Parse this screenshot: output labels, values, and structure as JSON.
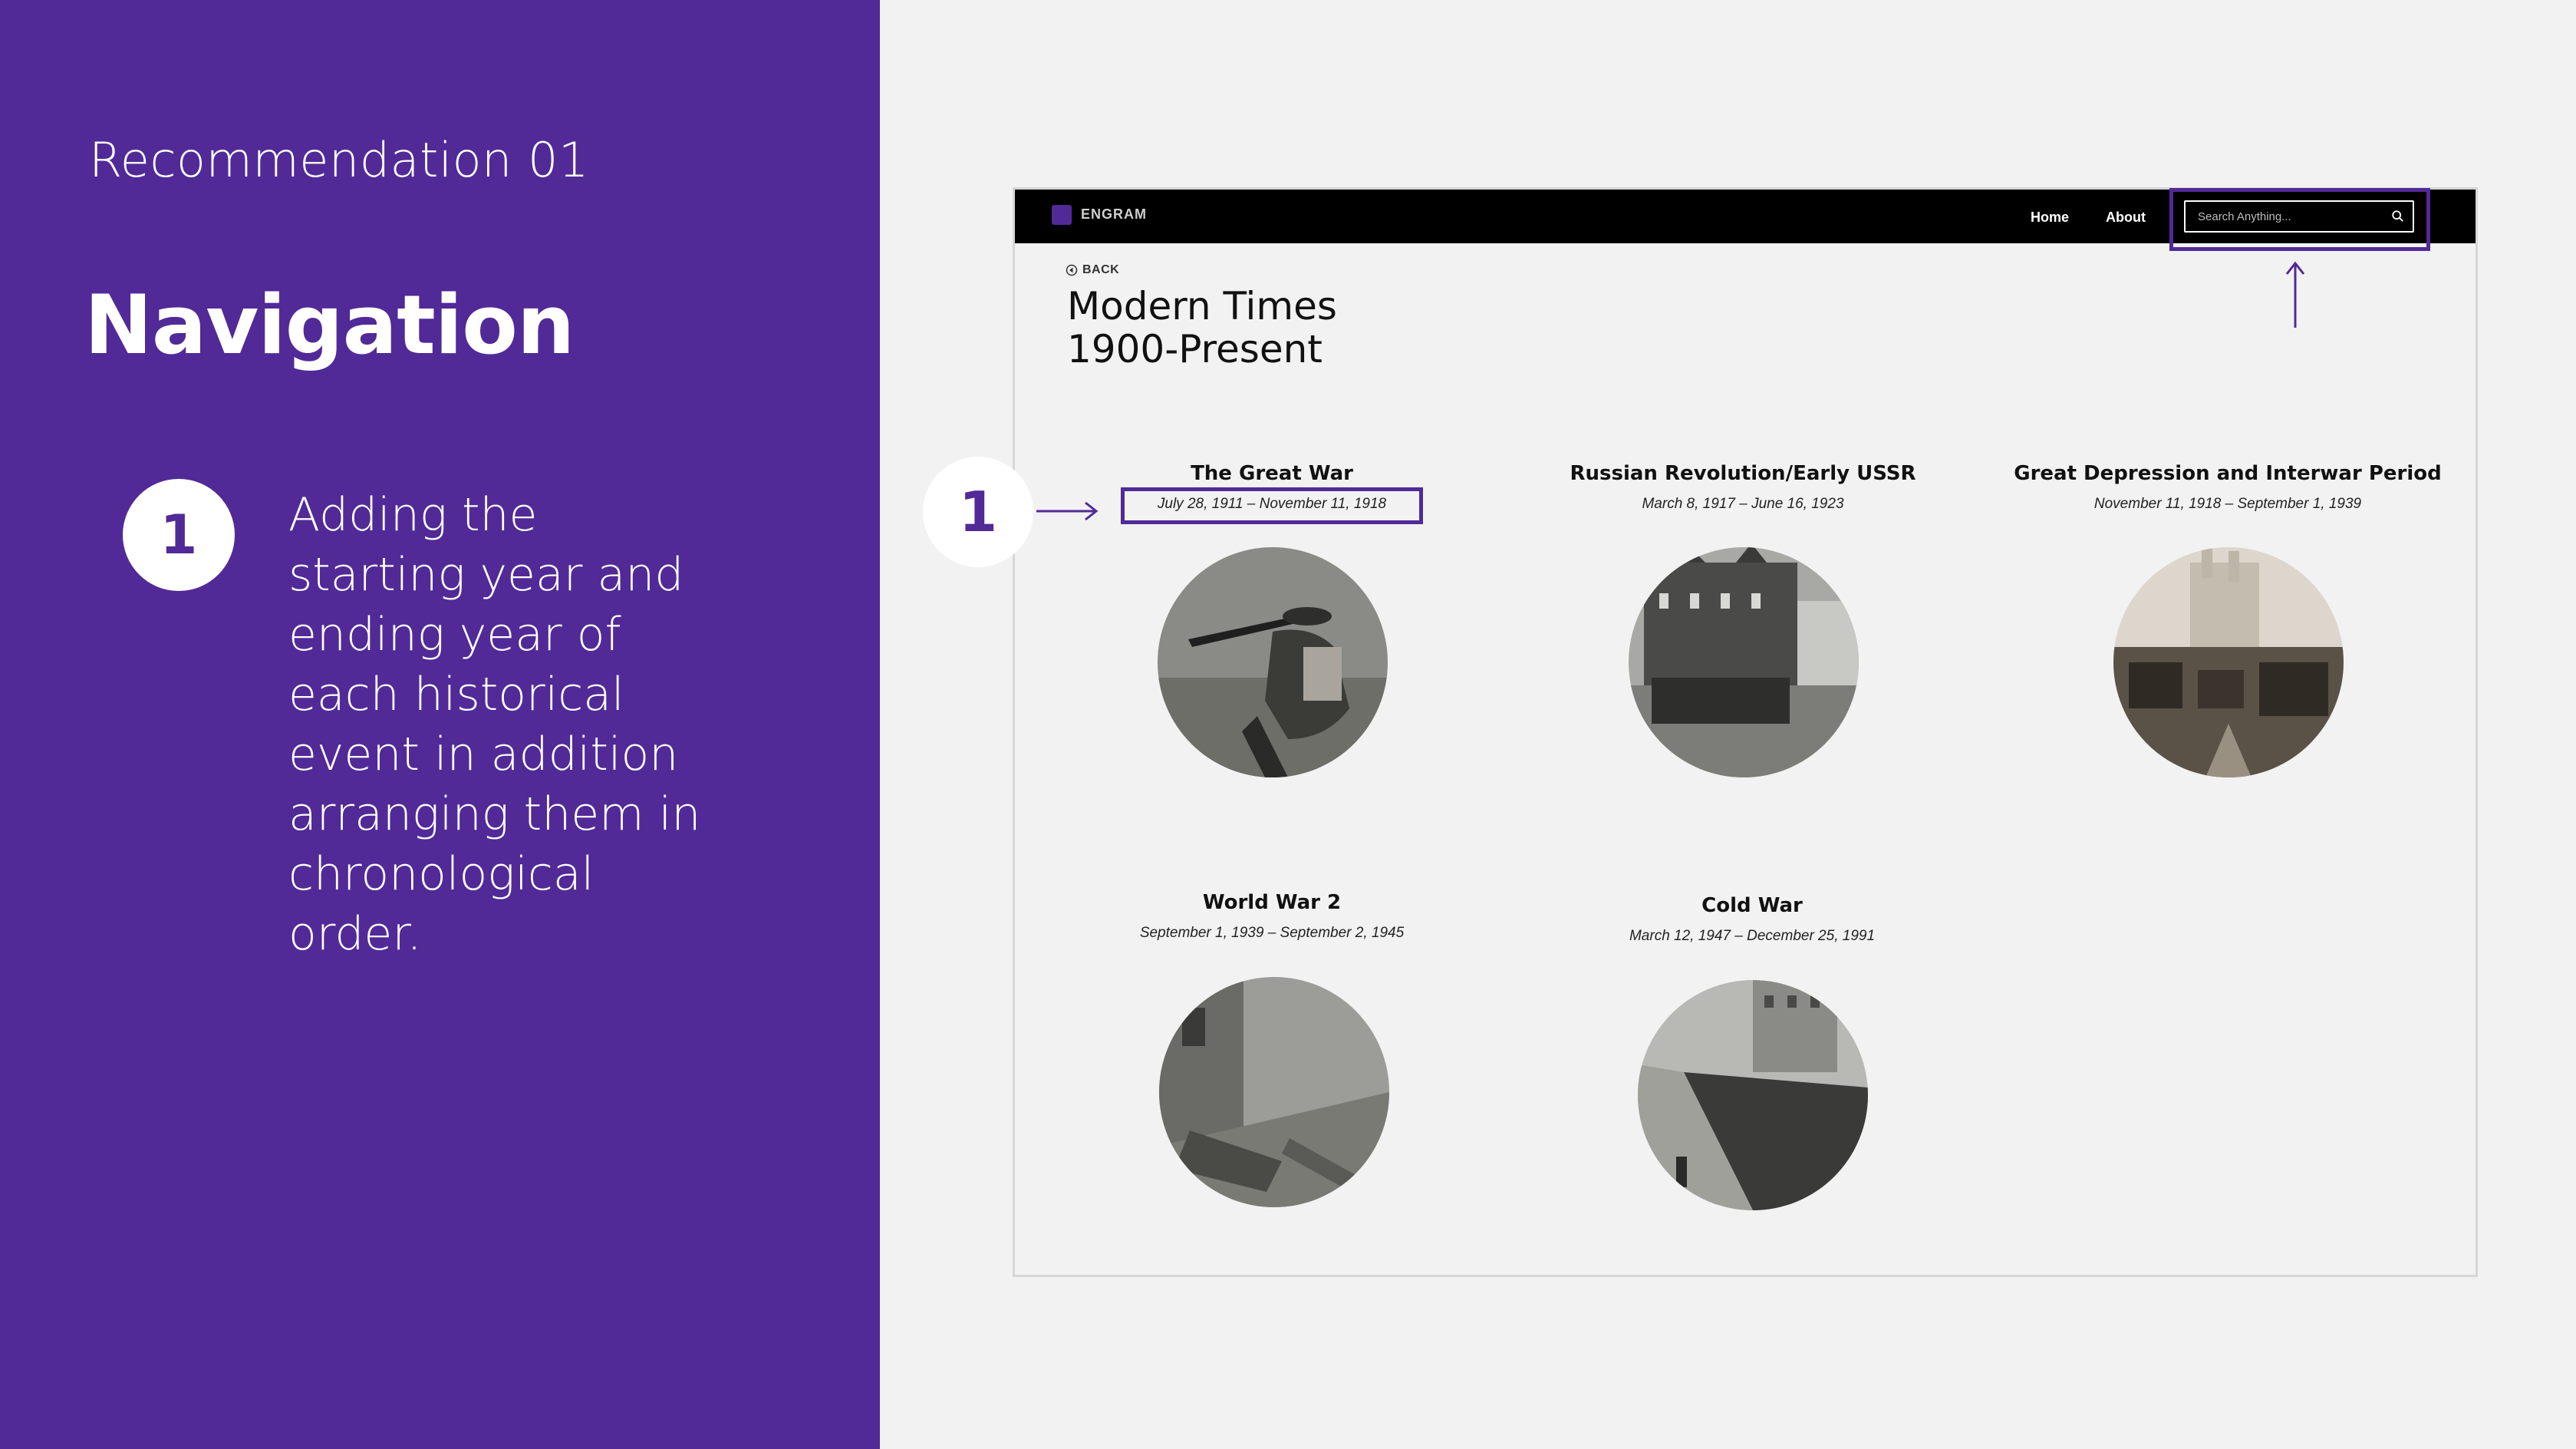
{
  "slide": {
    "recommendation_label": "Recommendation 01",
    "heading": "Navigation",
    "step_number": "1",
    "step_text": "Adding the starting year and ending year of each historical event in addition arranging them in chronological order.",
    "accent_color": "#512a97"
  },
  "website": {
    "logo_text": "ENGRAM",
    "nav": {
      "home": "Home",
      "about": "About"
    },
    "search_placeholder": "Search Anything...",
    "back_label": "BACK",
    "page_title_line1": "Modern Times",
    "page_title_line2": "1900-Present",
    "callout_number": "1",
    "cards": [
      {
        "title": "The Great War",
        "date": "July 28, 1911 – November 11, 1918",
        "image": "soldier-aiming-rifle"
      },
      {
        "title": "Russian Revolution/Early USSR",
        "date": "March 8, 1917 – June 16, 1923",
        "image": "troops-in-square"
      },
      {
        "title": "Great Depression and Interwar Period",
        "date": "November 11, 1918 – September 1, 1939",
        "image": "shantytown"
      },
      {
        "title": "World War 2",
        "date": "September 1, 1939 – September 2, 1945",
        "image": "soldiers-in-rubble"
      },
      {
        "title": "Cold War",
        "date": "March 12, 1947 – December 25, 1991",
        "image": "berlin-wall-path"
      }
    ]
  }
}
